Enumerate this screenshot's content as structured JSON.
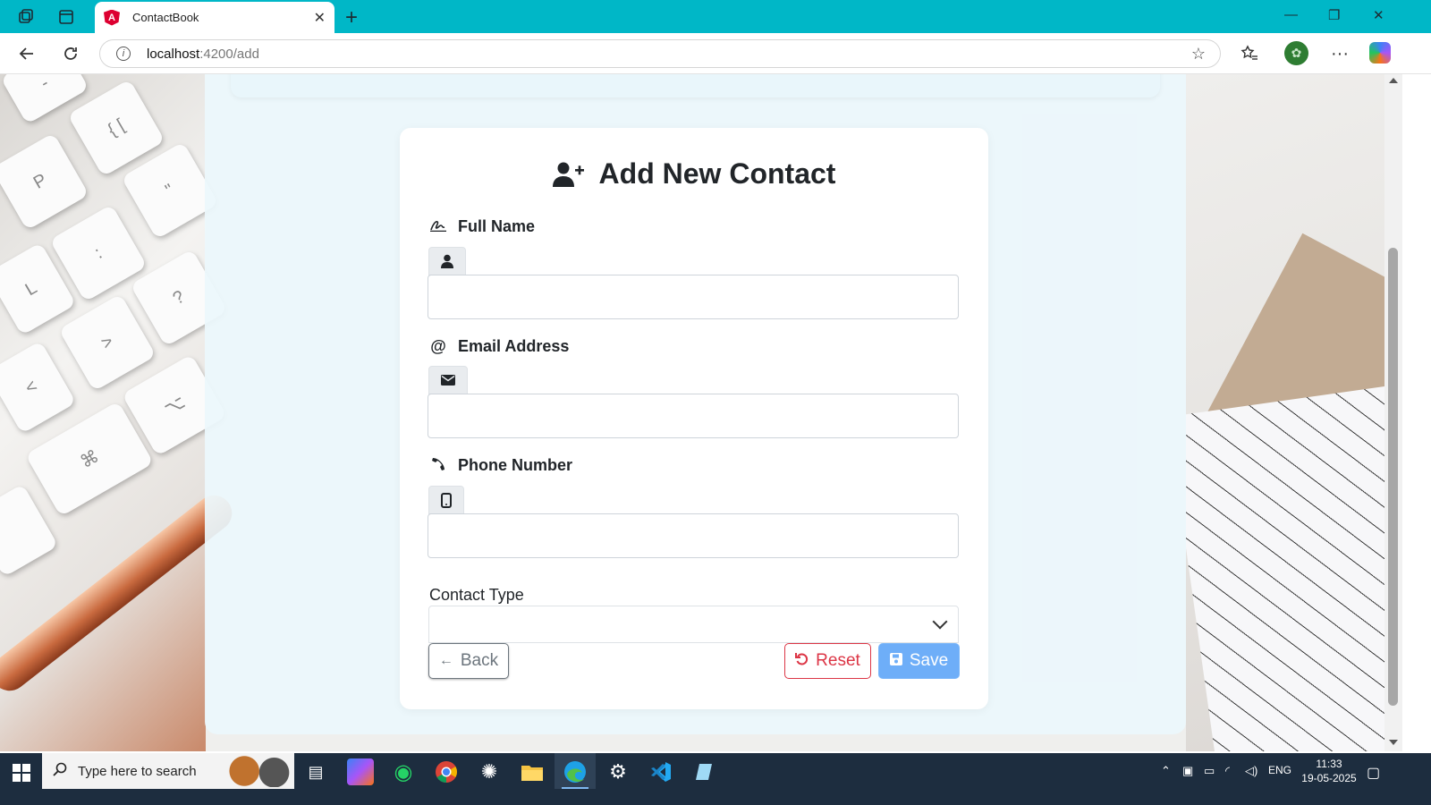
{
  "browser": {
    "tab_title": "ContactBook",
    "url_host": "localhost",
    "url_path": ":4200/add"
  },
  "form": {
    "title": "Add New Contact",
    "full_name_label": "Full Name",
    "email_label": "Email Address",
    "phone_label": "Phone Number",
    "contact_type_label": "Contact Type",
    "contact_type_value": "",
    "back_label": "Back",
    "reset_label": "Reset",
    "save_label": "Save"
  },
  "taskbar": {
    "search_placeholder": "Type here to search",
    "language": "ENG",
    "time": "11:33",
    "date": "19-05-2025"
  },
  "colors": {
    "tabbar": "#00b7c7",
    "reset": "#dc3545",
    "save": "#6eaef8",
    "taskbar": "#1d2d3f"
  }
}
